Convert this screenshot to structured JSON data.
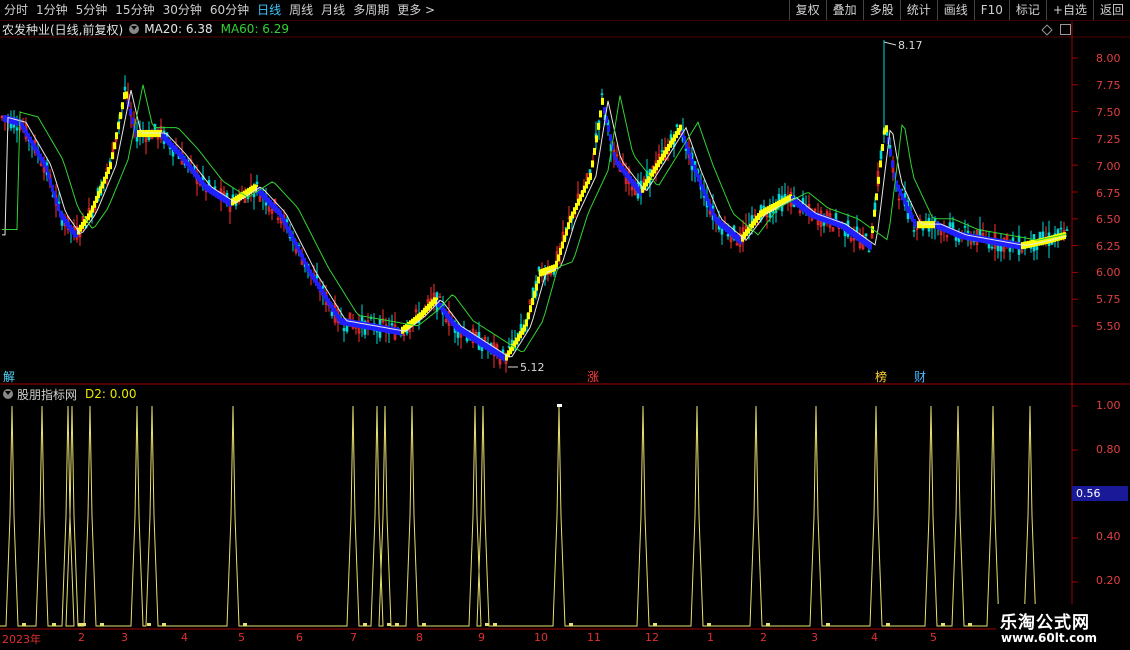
{
  "toolbar": {
    "periods": [
      "分时",
      "1分钟",
      "5分钟",
      "15分钟",
      "30分钟",
      "60分钟",
      "日线",
      "周线",
      "月线",
      "多周期",
      "更多 >"
    ],
    "active_period": "日线",
    "right_buttons": [
      "复权",
      "叠加",
      "多股",
      "统计",
      "画线",
      "F10",
      "标记",
      "+自选",
      "返回"
    ]
  },
  "chart_header": {
    "stock_name": "农发种业(日线,前复权)",
    "ma20": "MA20: 6.38",
    "ma60": "MA60: 6.29"
  },
  "price_axis": [
    "8.00",
    "7.75",
    "7.50",
    "7.25",
    "7.00",
    "6.75",
    "6.50",
    "6.25",
    "6.00",
    "5.75",
    "5.50"
  ],
  "annotations": {
    "high": "8.17",
    "low": "5.12"
  },
  "event_markers": [
    "解",
    "涨",
    "榜",
    "财"
  ],
  "indicator": {
    "name": "股朋指标网",
    "d2": "D2: 0.00",
    "axis": [
      "1.00",
      "0.80",
      "0.40",
      "0.20"
    ],
    "current_value": "0.56"
  },
  "date_axis": [
    "2023年",
    "2",
    "3",
    "4",
    "5",
    "6",
    "7",
    "8",
    "9",
    "10",
    "11",
    "12",
    "1",
    "2",
    "3",
    "4",
    "5"
  ],
  "watermark": {
    "line1": "乐淘公式网",
    "line2": "www.60lt.com"
  },
  "colors": {
    "up": "#ff3030",
    "down": "#00d8d8",
    "bull_signal": "#ffff00",
    "bear_signal": "#2020ff",
    "ma20": "#e6e6e6",
    "ma60": "#32d232",
    "indicator": "#e8e070"
  }
}
